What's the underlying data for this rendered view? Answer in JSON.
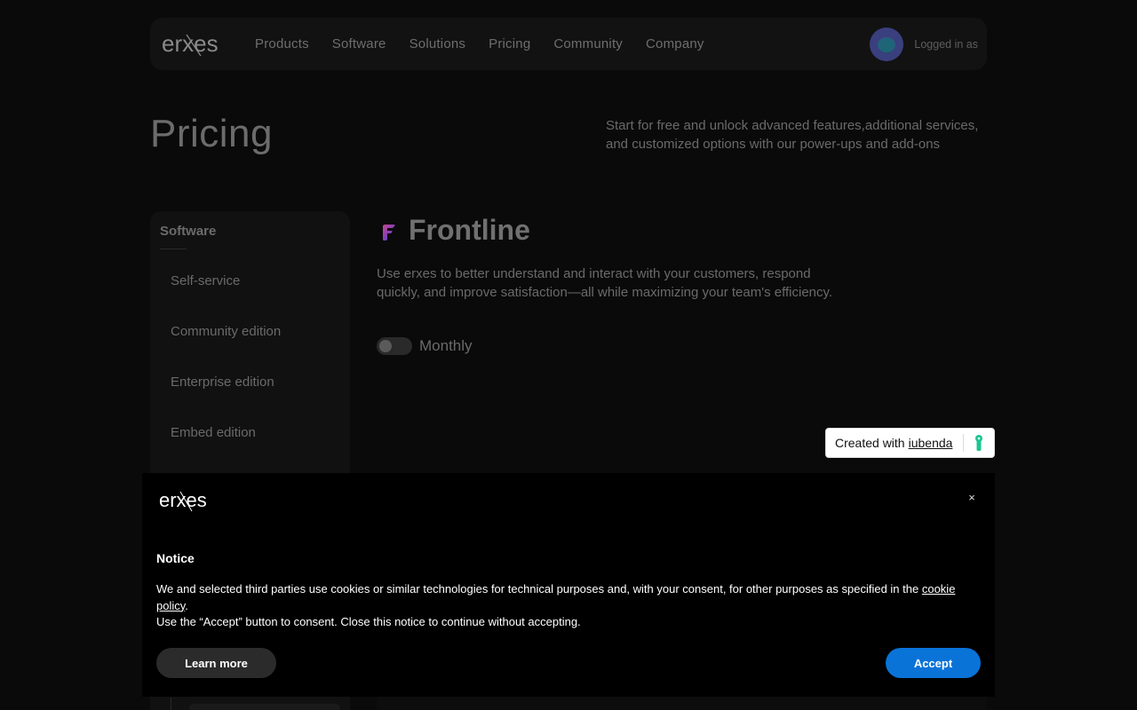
{
  "brand": {
    "logo_text": "erxes"
  },
  "nav": {
    "links": [
      "Products",
      "Software",
      "Solutions",
      "Pricing",
      "Community",
      "Company"
    ],
    "logged_text": "Logged in as"
  },
  "header": {
    "title": "Pricing",
    "subtitle": "Start for free and unlock advanced features,additional services, and customized options with our power-ups and add-ons"
  },
  "sidebar": {
    "heading": "Software",
    "items": [
      "Self-service",
      "Community edition",
      "Enterprise edition",
      "Embed edition"
    ]
  },
  "product": {
    "name": "Frontline",
    "description": "Use erxes to better understand and interact with your customers, respond quickly, and improve satisfaction—all while maximizing your team's efficiency.",
    "billing_label": "Monthly",
    "billing_toggle_on": false
  },
  "iubenda": {
    "prefix": "Created with",
    "link": "iubenda"
  },
  "cookie": {
    "title": "Notice",
    "text_part1": "We and selected third parties use cookies or similar technologies for technical purposes and, with your consent, for other purposes as specified in the ",
    "policy_link": "cookie policy",
    "text_part2": ".",
    "text_line2": "Use the “Accept” button to consent. Close this notice to continue without accepting.",
    "close_symbol": "×",
    "learn_more": "Learn more",
    "accept": "Accept"
  },
  "colors": {
    "accept_blue": "#0a73d8",
    "iubenda_green": "#1cc691",
    "background": "#0b0b0b"
  }
}
